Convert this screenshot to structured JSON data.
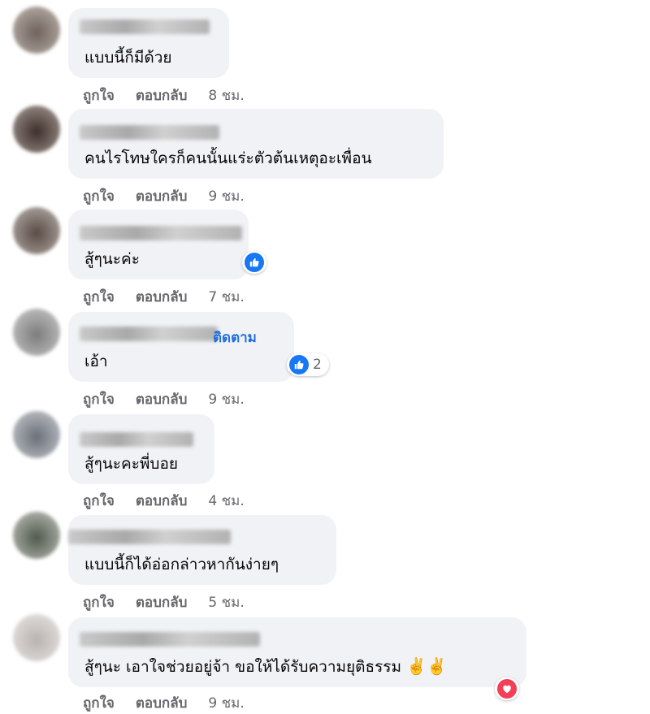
{
  "labels": {
    "like": "ถูกใจ",
    "reply": "ตอบกลับ"
  },
  "comments": [
    {
      "text": "แบบนี้ก็มีด้วย",
      "time": "8 ชม."
    },
    {
      "text": "คนไรโทษใครก็คนนั้นแร่ะตัวต้นเหตุอะเพื่อน",
      "time": "9 ชม."
    },
    {
      "text": "สู้ๆนะค่ะ",
      "time": "7 ชม.",
      "reaction": "like"
    },
    {
      "text": "เอ้า",
      "time": "9 ชม.",
      "follow": "ติดตาม",
      "reaction": "like",
      "reaction_count": "2"
    },
    {
      "text": "สู้ๆนะคะพี่บอย",
      "time": "4 ชม."
    },
    {
      "text": "แบบนี้ก็ได้อ่อกล่าวหากันง่ายๆ",
      "time": "5 ชม."
    },
    {
      "text": "สู้ๆนะ เอาใจช่วยอยู่จ้า ขอให้ได้รับความยุติธรรม",
      "emoji": "✌️✌️",
      "time": "9 ชม.",
      "reaction": "love"
    }
  ],
  "colors": {
    "bubble": "#f0f2f5",
    "link": "#216fdb",
    "like": "#1877f2",
    "love": "#f33e58",
    "meta": "#65676b"
  }
}
